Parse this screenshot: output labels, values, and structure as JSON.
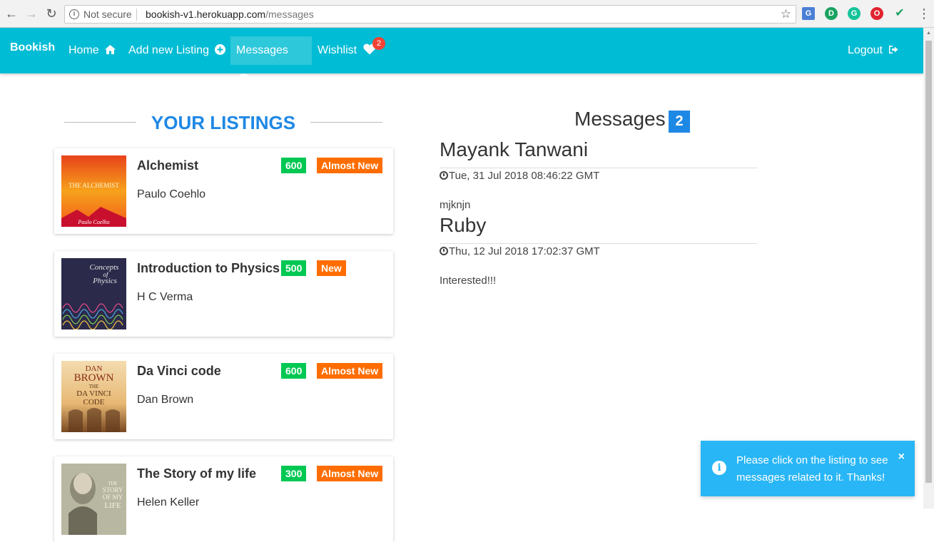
{
  "browser": {
    "security_label": "Not secure",
    "url_host": "bookish-v1.herokuapp.com",
    "url_path": "/messages"
  },
  "navbar": {
    "brand": "Bookish",
    "items": [
      {
        "label": "Home",
        "icon": "home-icon"
      },
      {
        "label": "Add new Listing",
        "icon": "plus-circle-icon"
      },
      {
        "label": "Messages",
        "icon": "comments-icon",
        "active": true
      },
      {
        "label": "Wishlist",
        "icon": "heart-icon"
      }
    ],
    "wishlist_count": "2",
    "logout": "Logout",
    "color": "#00bcd4"
  },
  "listings": {
    "heading": "YOUR LISTINGS",
    "items": [
      {
        "title": "Alchemist",
        "author": "Paulo Coehlo",
        "price": "600",
        "condition": "Almost New"
      },
      {
        "title": "Introduction to Physics",
        "author": "H C Verma",
        "price": "500",
        "condition": "New"
      },
      {
        "title": "Da Vinci code",
        "author": "Dan Brown",
        "price": "600",
        "condition": "Almost New"
      },
      {
        "title": "The Story of my life",
        "author": "Helen Keller",
        "price": "300",
        "condition": "Almost New"
      }
    ]
  },
  "messages": {
    "heading": "Messages",
    "count": "2",
    "items": [
      {
        "sender": "Mayank Tanwani",
        "time": "Tue, 31 Jul 2018 08:46:22 GMT",
        "body": "mjknjn"
      },
      {
        "sender": "Ruby",
        "time": "Thu, 12 Jul 2018 17:02:37 GMT",
        "body": "Interested!!!"
      }
    ]
  },
  "toast": {
    "text": "Please click on the listing to see messages related to it. Thanks!",
    "close": "×"
  },
  "covers": {
    "alchemist": {
      "title": "THE ALCHEMIST",
      "author": "Paulo Coelho"
    },
    "physics": {
      "title1": "Concepts",
      "title2": "of",
      "title3": "Physics"
    },
    "davinci": {
      "l1": "DAN",
      "l2": "BROWN",
      "l3": "THE",
      "l4": "DA VINCI",
      "l5": "CODE"
    },
    "story": {
      "l1": "THE",
      "l2": "STORY",
      "l3": "OF MY",
      "l4": "LIFE"
    }
  }
}
